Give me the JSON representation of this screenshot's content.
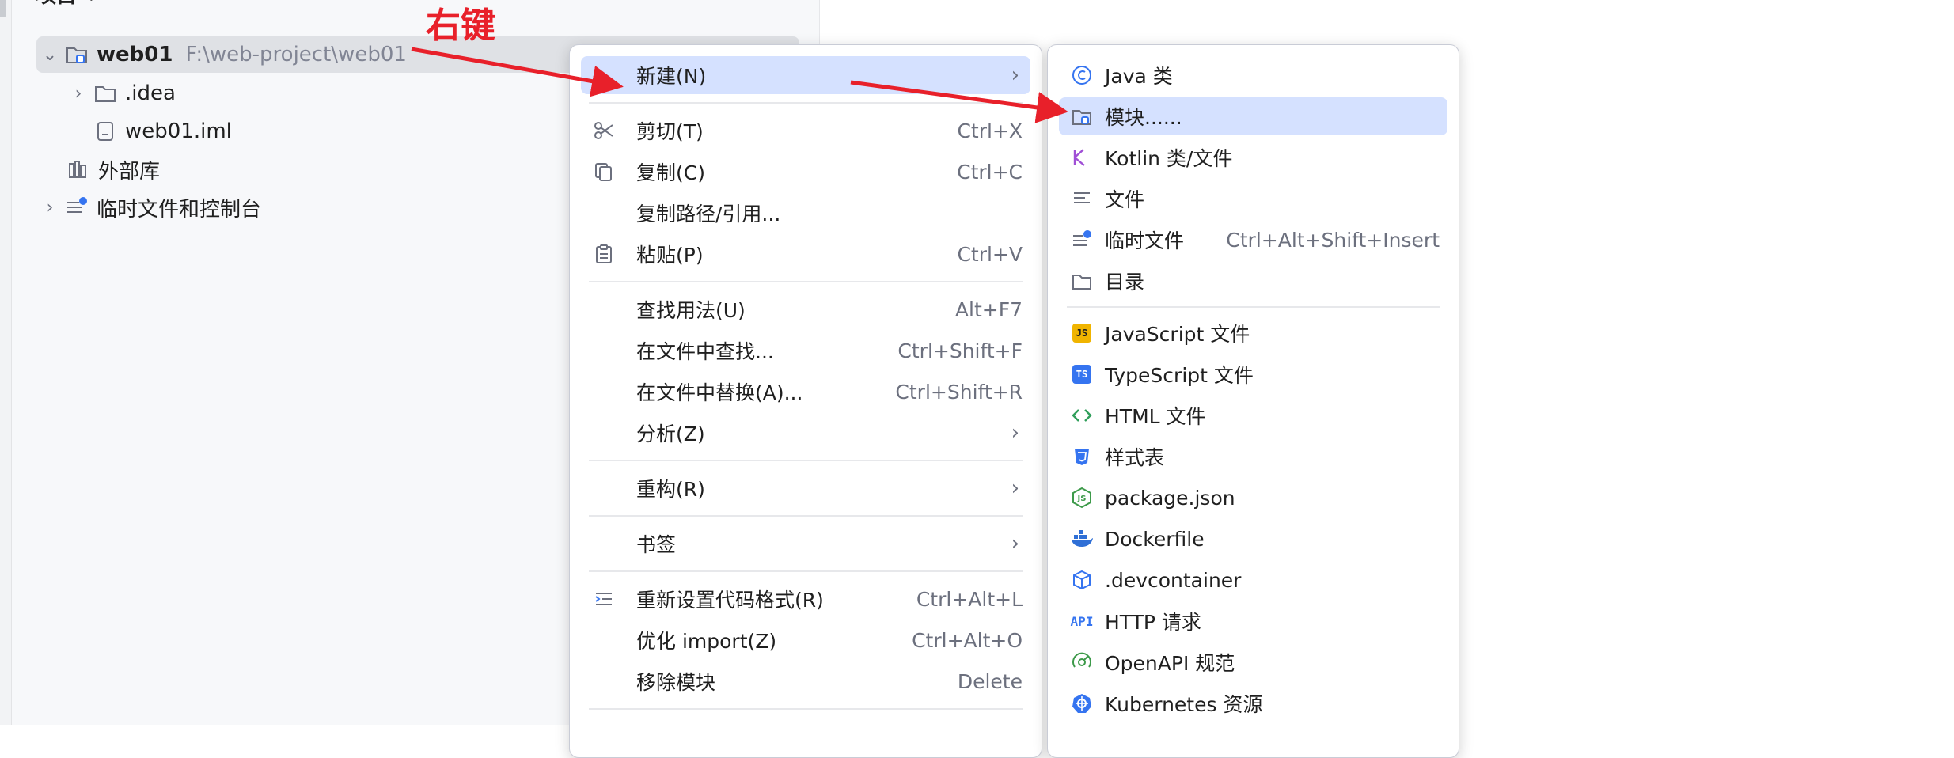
{
  "panel": {
    "title": "项目",
    "title_chevron": "⌄"
  },
  "annotation": {
    "label": "右键",
    "color": "#e8202a"
  },
  "tree": {
    "root": {
      "name": "web01",
      "path": "F:\\web-project\\web01"
    },
    "idea": {
      "name": ".idea"
    },
    "iml": {
      "name": "web01.iml"
    },
    "ext_libs": {
      "name": "外部库"
    },
    "scratches": {
      "name": "临时文件和控制台"
    }
  },
  "context_menu": {
    "new": {
      "label": "新建(N)"
    },
    "cut": {
      "label": "剪切(T)",
      "shortcut": "Ctrl+X"
    },
    "copy": {
      "label": "复制(C)",
      "shortcut": "Ctrl+C"
    },
    "copy_path": {
      "label": "复制路径/引用..."
    },
    "paste": {
      "label": "粘贴(P)",
      "shortcut": "Ctrl+V"
    },
    "find_usages": {
      "label": "查找用法(U)",
      "shortcut": "Alt+F7"
    },
    "find_in_files": {
      "label": "在文件中查找...",
      "shortcut": "Ctrl+Shift+F"
    },
    "replace_in_files": {
      "label": "在文件中替换(A)...",
      "shortcut": "Ctrl+Shift+R"
    },
    "analyze": {
      "label": "分析(Z)"
    },
    "refactor": {
      "label": "重构(R)"
    },
    "bookmarks": {
      "label": "书签"
    },
    "reformat": {
      "label": "重新设置代码格式(R)",
      "shortcut": "Ctrl+Alt+L"
    },
    "optimize_imports": {
      "label": "优化 import(Z)",
      "shortcut": "Ctrl+Alt+O"
    },
    "remove_module": {
      "label": "移除模块",
      "shortcut": "Delete"
    }
  },
  "submenu": {
    "java_class": {
      "label": "Java 类"
    },
    "module": {
      "label": "模块......"
    },
    "kotlin": {
      "label": "Kotlin 类/文件"
    },
    "file": {
      "label": "文件"
    },
    "scratch_file": {
      "label": "临时文件",
      "shortcut": "Ctrl+Alt+Shift+Insert"
    },
    "directory": {
      "label": "目录"
    },
    "javascript": {
      "label": "JavaScript 文件",
      "badge": "JS"
    },
    "typescript": {
      "label": "TypeScript 文件",
      "badge": "TS"
    },
    "html": {
      "label": "HTML 文件"
    },
    "stylesheet": {
      "label": "样式表"
    },
    "package_json": {
      "label": "package.json"
    },
    "dockerfile": {
      "label": "Dockerfile"
    },
    "devcontainer": {
      "label": ".devcontainer"
    },
    "http_request": {
      "label": "HTTP 请求",
      "badge": "API"
    },
    "openapi": {
      "label": "OpenAPI 规范"
    },
    "kubernetes": {
      "label": "Kubernetes 资源"
    }
  },
  "colors": {
    "highlight": "#d5e1ff",
    "selection": "#dfe1e5",
    "accent": "#3574f0",
    "arrow": "#e8202a"
  }
}
